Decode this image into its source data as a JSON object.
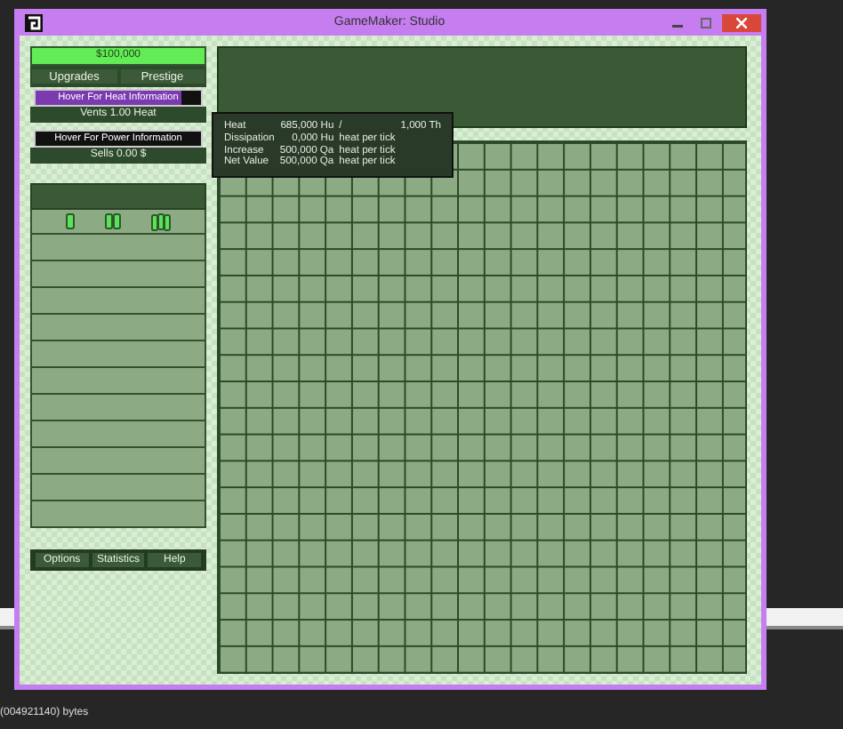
{
  "window": {
    "title": "GameMaker: Studio"
  },
  "money": "$100,000",
  "top_buttons": [
    "Upgrades",
    "Prestige"
  ],
  "heat_bar": {
    "label": "Hover For Heat Information",
    "level": 0.88
  },
  "vents": "Vents 1.00 Heat",
  "power_bar": {
    "label": "Hover For Power Information"
  },
  "sells": "Sells 0.00 $",
  "bottom_buttons": [
    "Options",
    "Statistics",
    "Help"
  ],
  "tooltip": {
    "rows": [
      {
        "label": "Heat",
        "value": "685,000 Hu",
        "unit": "/",
        "extra": "1,000 Th"
      },
      {
        "label": "Dissipation",
        "value": "0,000 Hu",
        "unit": "heat per tick"
      },
      {
        "label": "Increase",
        "value": "500,000 Qa",
        "unit": "heat per tick"
      },
      {
        "label": "Net Value",
        "value": "500,000 Qa",
        "unit": "heat per tick"
      }
    ]
  },
  "console": {
    "text": "(004921140) bytes"
  }
}
